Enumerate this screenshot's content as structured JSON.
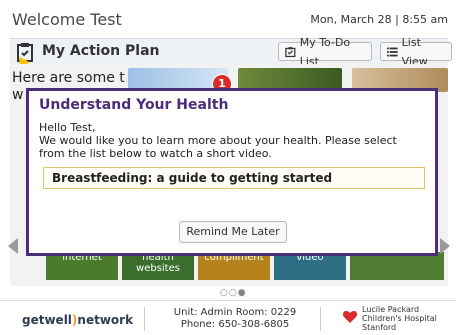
{
  "header": {
    "welcome": "Welcome Test",
    "datetime": "Mon, March 28 | 8:55 am"
  },
  "plan_bar": {
    "title": "My Action Plan",
    "todo_label": "My To-Do List",
    "list_view_label": "List View"
  },
  "carousel": {
    "intro_text": "Here are some t w t a",
    "badge_count": "1",
    "tiles": [
      {
        "label": "internet"
      },
      {
        "label": "health websites"
      },
      {
        "label": "compliment"
      },
      {
        "label": "video"
      },
      {
        "label": ""
      }
    ]
  },
  "modal": {
    "title": "Understand Your Health",
    "greeting": "Hello Test,",
    "message": "We would like you to learn more about your health. Please select from the list below to watch a short video.",
    "highlight_item": "Breastfeeding: a guide to getting started",
    "remind_label": "Remind Me Later"
  },
  "pager": "○○●",
  "footer": {
    "brand_prefix": "getwell",
    "brand_accent": ")",
    "brand_suffix": "network",
    "unit_line1": "Unit: Admin Room: 0229",
    "unit_line2": "Phone: 650-308-6805",
    "hospital_line1": "Lucile Packard",
    "hospital_line2": "Children's Hospital",
    "hospital_line3": "Stanford"
  },
  "colors": {
    "modal_border": "#4b2d7a",
    "highlight_border": "#e1c46b",
    "badge": "#d92b2b",
    "brand_accent": "#f2a01d"
  },
  "icons": {
    "plan": "clipboard-icon",
    "todo": "clipboard-check-icon",
    "list_view": "list-icon",
    "hospital": "heart-logo-icon"
  }
}
